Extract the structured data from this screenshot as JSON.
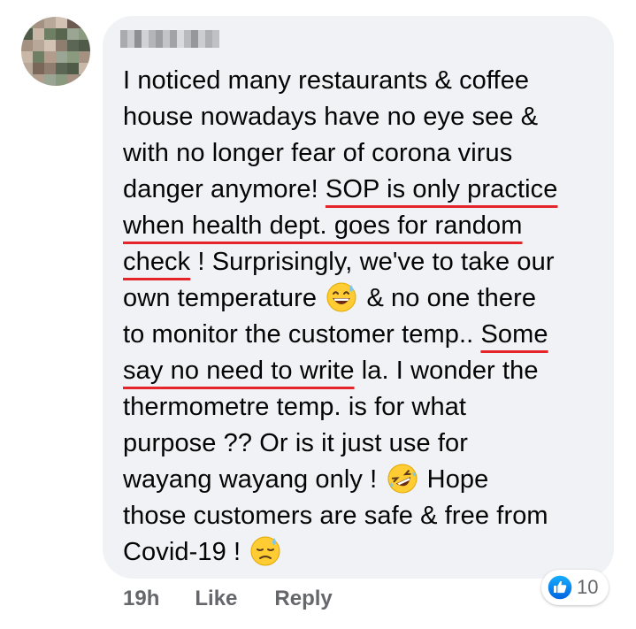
{
  "comment": {
    "lines": [
      [
        {
          "t": "I noticed many restaurants &  coffee"
        }
      ],
      [
        {
          "t": "house nowadays have no eye see &"
        }
      ],
      [
        {
          "t": "with no longer fear of corona virus"
        }
      ],
      [
        {
          "t": "danger anymore! "
        },
        {
          "t": "SOP is only practice",
          "u": true
        }
      ],
      [
        {
          "t": "when health dept. goes for random",
          "u": true
        }
      ],
      [
        {
          "t": "check",
          "u": true
        },
        {
          "t": " ! Surprisingly, we've to take our"
        }
      ],
      [
        {
          "t": "own temperature "
        },
        {
          "e": "grin-sweat-emoji"
        },
        {
          "t": " & no one there"
        }
      ],
      [
        {
          "t": "to monitor the customer temp.. "
        },
        {
          "t": "Some",
          "u": true
        }
      ],
      [
        {
          "t": "say no need to write",
          "u": true
        },
        {
          "t": " la. I wonder the"
        }
      ],
      [
        {
          "t": "thermometre temp. is for what"
        }
      ],
      [
        {
          "t": "purpose ?? Or is it just use for"
        }
      ],
      [
        {
          "t": "wayang wayang only !  "
        },
        {
          "e": "rolling-laughing-emoji"
        },
        {
          "t": " Hope"
        }
      ],
      [
        {
          "t": "those customers are safe & free from"
        }
      ],
      [
        {
          "t": "Covid-19 ! "
        },
        {
          "e": "downcast-sweat-emoji"
        }
      ]
    ]
  },
  "actions": {
    "time": "19h",
    "like_label": "Like",
    "reply_label": "Reply"
  },
  "reactions": {
    "icon": "thumbs-up-icon",
    "count": "10"
  },
  "colors": {
    "bubble": "#f0f2f5",
    "underline": "#e4262b",
    "like_blue": "#1877f2",
    "secondary_text": "#65676b"
  }
}
